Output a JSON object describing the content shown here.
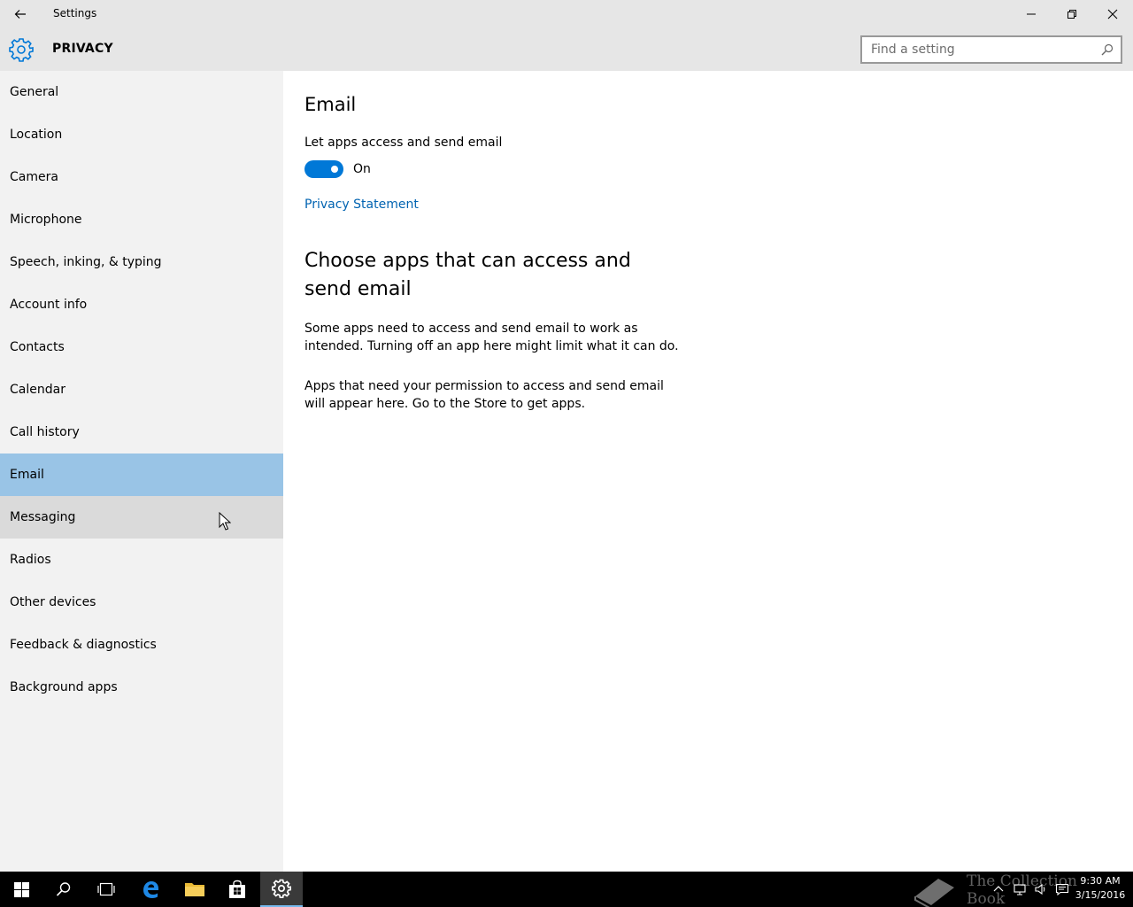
{
  "window": {
    "title": "Settings",
    "back_icon": "back-arrow-icon",
    "minimize_icon": "minimize-icon",
    "restore_icon": "restore-icon",
    "close_icon": "close-icon"
  },
  "header": {
    "title": "PRIVACY",
    "icon": "gear-icon",
    "search": {
      "placeholder": "Find a setting",
      "value": ""
    }
  },
  "sidebar": {
    "selected": "Email",
    "hovered": "Messaging",
    "items": [
      {
        "label": "General"
      },
      {
        "label": "Location"
      },
      {
        "label": "Camera"
      },
      {
        "label": "Microphone"
      },
      {
        "label": "Speech, inking, & typing"
      },
      {
        "label": "Account info"
      },
      {
        "label": "Contacts"
      },
      {
        "label": "Calendar"
      },
      {
        "label": "Call history"
      },
      {
        "label": "Email"
      },
      {
        "label": "Messaging"
      },
      {
        "label": "Radios"
      },
      {
        "label": "Other devices"
      },
      {
        "label": "Feedback & diagnostics"
      },
      {
        "label": "Background apps"
      }
    ]
  },
  "main": {
    "heading": "Email",
    "toggle_label": "Let apps access and send email",
    "toggle_state": "On",
    "privacy_link": "Privacy Statement",
    "section_heading": "Choose apps that can access and send email",
    "paragraph1": "Some apps need to access and send email to work as intended. Turning off an app here might limit what it can do.",
    "paragraph2": "Apps that need your permission to access and send email will appear here. Go to the Store to get apps."
  },
  "taskbar": {
    "watermark": "The Collection Book",
    "time": "9:30 AM",
    "date": "3/15/2016"
  },
  "colors": {
    "accent": "#0078d7",
    "link": "#0063b1",
    "selected": "#99c4e6",
    "hover": "#dadada",
    "sidebar_bg": "#f2f2f2",
    "titlebar_bg": "#e6e6e6"
  }
}
